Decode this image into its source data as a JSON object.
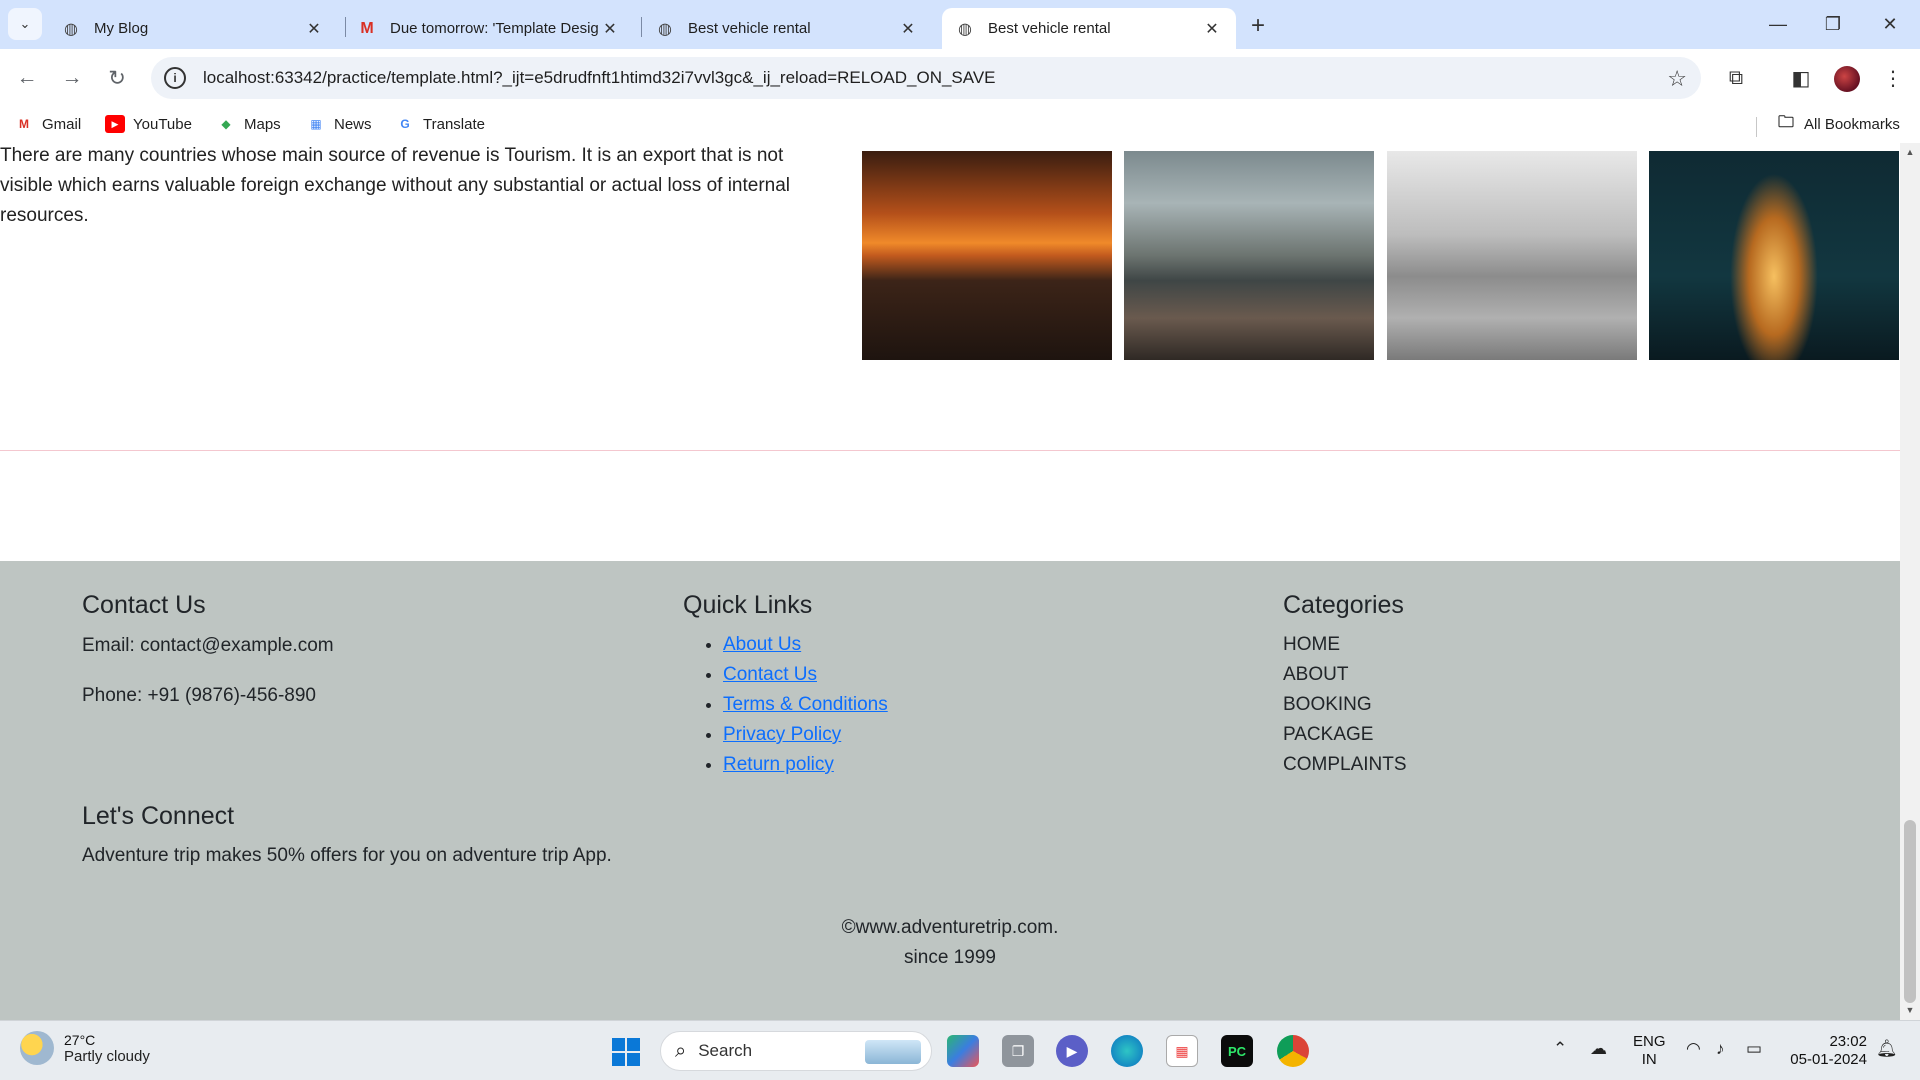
{
  "browser": {
    "tabs": [
      {
        "title": "My Blog",
        "icon": "globe-icon"
      },
      {
        "title": "Due tomorrow: 'Template Desig",
        "icon": "gmail-icon"
      },
      {
        "title": "Best vehicle rental",
        "icon": "globe-icon"
      },
      {
        "title": "Best vehicle rental",
        "icon": "globe-icon",
        "active": true
      }
    ],
    "url": "localhost:63342/practice/template.html?_ijt=e5drudfnft1htimd32i7vvl3gc&_ij_reload=RELOAD_ON_SAVE",
    "bookmarks": [
      "Gmail",
      "YouTube",
      "Maps",
      "News",
      "Translate"
    ],
    "all_bookmarks": "All Bookmarks"
  },
  "page": {
    "intro_text": "There are many countries whose main source of revenue is Tourism. It is an export that is not visible which earns valuable foreign exchange without any substantial or actual loss of internal resources.",
    "gallery": [
      "sunset-birds-photo",
      "city-harbor-gulls-photo",
      "flock-birds-photo",
      "eiffel-tower-photo"
    ],
    "footer": {
      "contact": {
        "heading": "Contact Us",
        "email": "Email: contact@example.com",
        "phone": "Phone: +91 (9876)-456-890"
      },
      "quick_links": {
        "heading": "Quick Links",
        "items": [
          "About Us",
          "Contact Us",
          "Terms & Conditions",
          "Privacy Policy",
          "Return policy"
        ]
      },
      "categories": {
        "heading": "Categories",
        "items": [
          "HOME",
          "ABOUT",
          "BOOKING",
          "PACKAGE",
          "COMPLAINTS"
        ]
      },
      "connect": {
        "heading": "Let's Connect",
        "text": "Adventure trip makes 50% offers for you on adventure trip App."
      },
      "copyright_line1": "©www.adventuretrip.com.",
      "copyright_line2": "since 1999"
    }
  },
  "taskbar": {
    "weather_temp": "27°C",
    "weather_desc": "Partly cloudy",
    "search_label": "Search",
    "lang_line1": "ENG",
    "lang_line2": "IN",
    "time": "23:02",
    "date": "05-01-2024"
  },
  "colors": {
    "footer_bg": "#bec5c2",
    "link": "#0d6efd",
    "tabbar": "#d3e3fd"
  }
}
